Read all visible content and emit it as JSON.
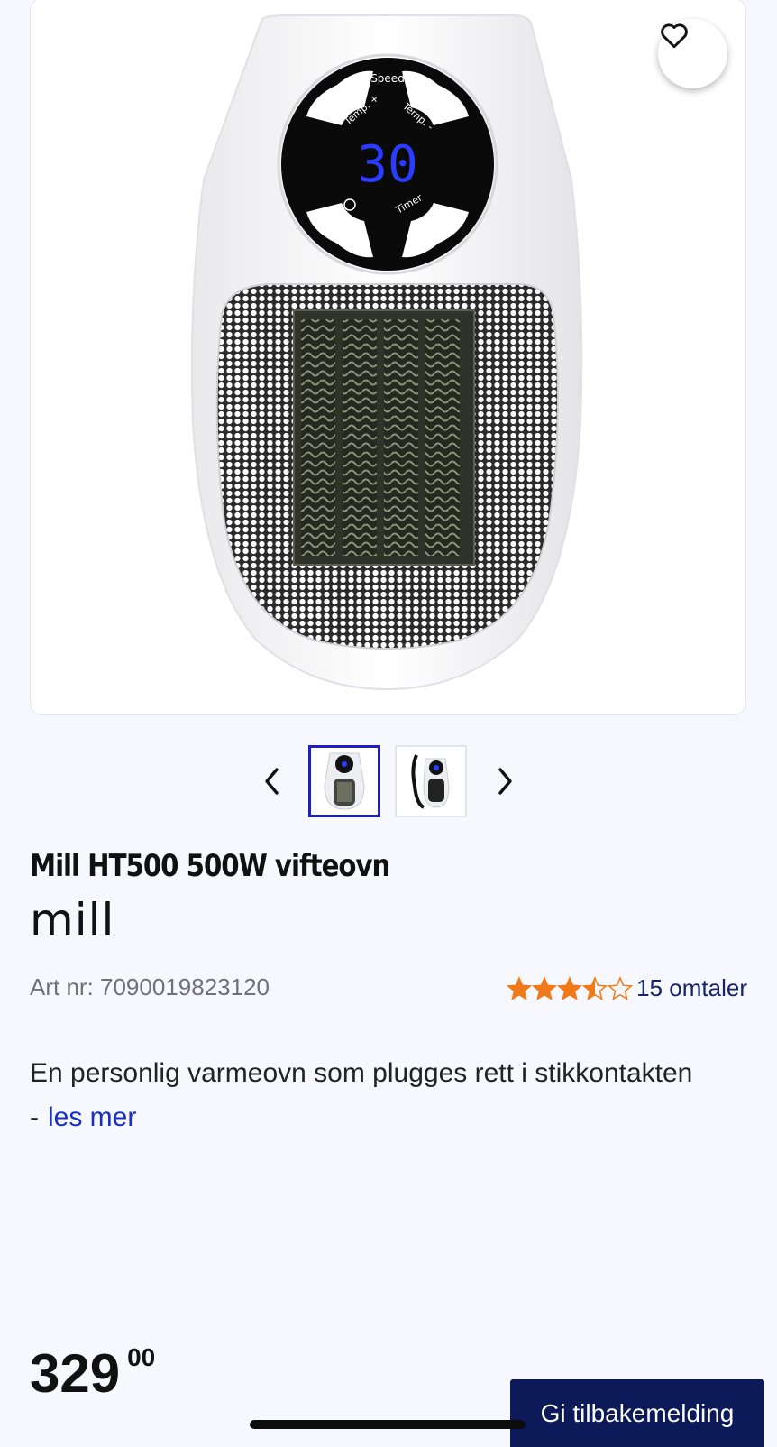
{
  "product": {
    "image_panel": {
      "display_lines": [
        "Speed",
        "Temp. +",
        "Temp. -",
        "30",
        "Timer"
      ]
    },
    "title": "Mill HT500 500W vifteovn",
    "brand": "mill",
    "art_nr": "Art nr: 7090019823120",
    "rating": {
      "stars": 3.5,
      "max": 5,
      "reviews_label": "15 omtaler"
    },
    "description": "En personlig varmeovn som plugges rett i stikkontakten -",
    "read_more": "les mer",
    "price": {
      "main": "329",
      "cents": "00"
    }
  },
  "gallery": {
    "image_count": 2,
    "active_index": 1
  },
  "feedback_button": "Gi tilbakemelding",
  "colors": {
    "background": "#f6f8fd",
    "star": "#f07a19",
    "link": "#1930c8",
    "reviews": "#17236b",
    "button": "#0d1a5a",
    "active_thumb": "#1d1fc4",
    "display_digits": "#2a3cff"
  },
  "icons": [
    "heart-icon",
    "chevron-left-icon",
    "chevron-right-icon",
    "star-icon"
  ]
}
